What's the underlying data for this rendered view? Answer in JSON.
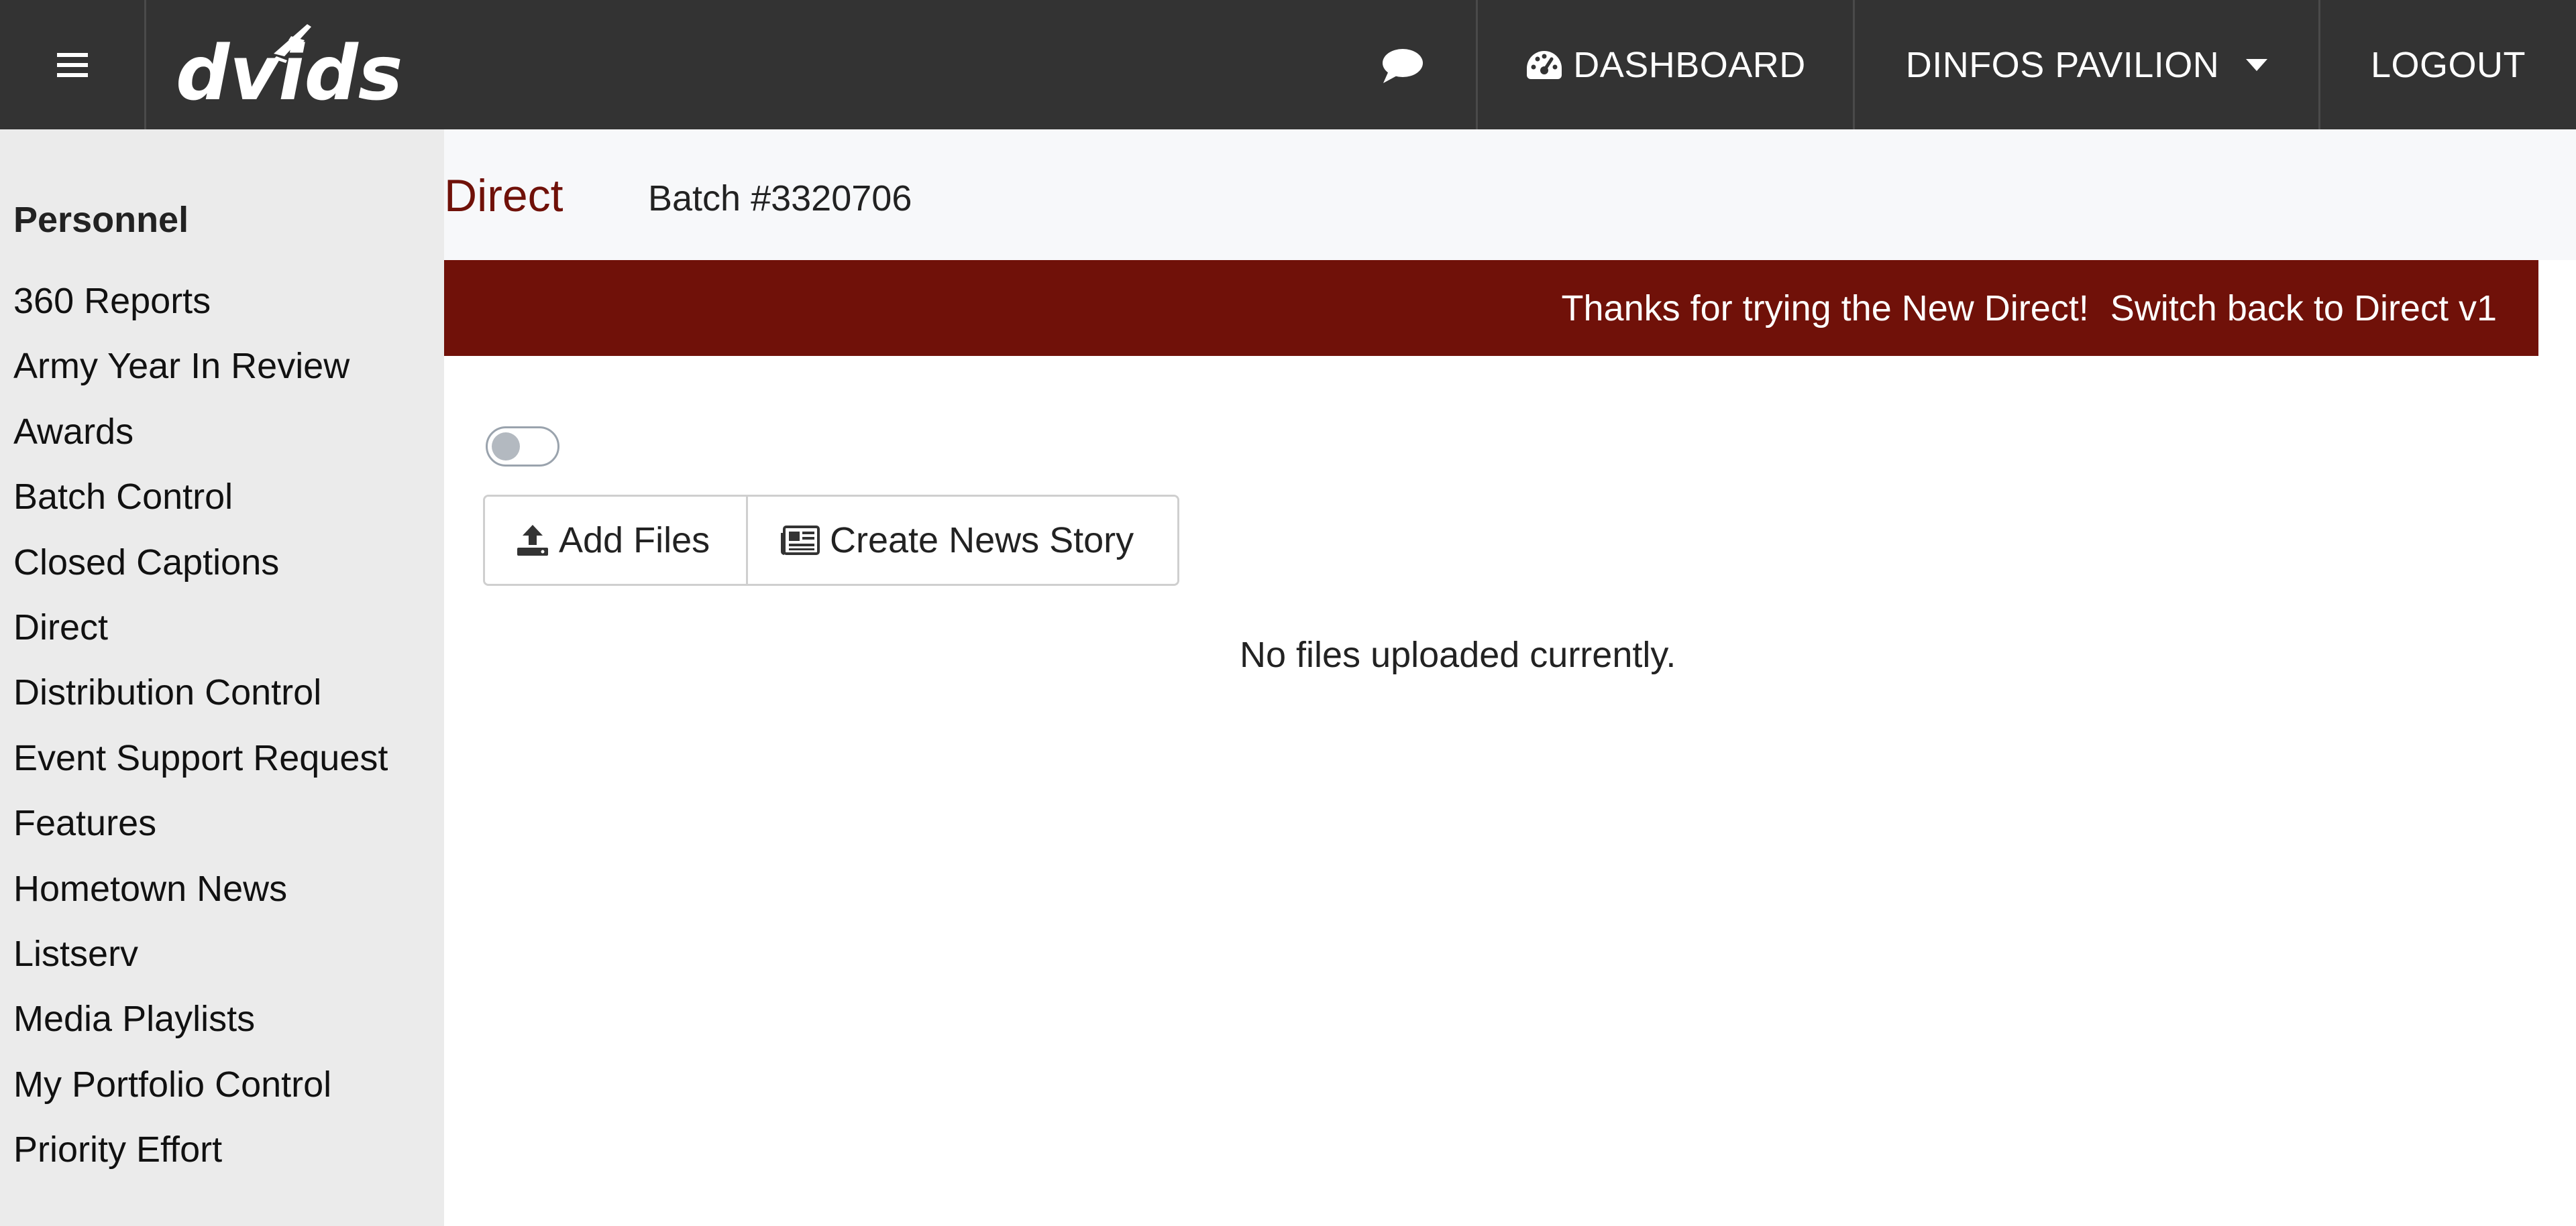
{
  "topbar": {
    "logo_text": "dvids",
    "nav": {
      "dashboard": "DASHBOARD",
      "pavilion": "DINFOS PAVILION",
      "logout": "LOGOUT"
    },
    "icons": {
      "menu": "hamburger-icon",
      "chat": "chat-bubble-icon",
      "dashboard": "speedometer-icon",
      "dropdown": "caret-down-icon"
    }
  },
  "sidebar": {
    "heading": "Personnel",
    "items": [
      "360 Reports",
      "Army Year In Review",
      "Awards",
      "Batch Control",
      "Closed Captions",
      "Direct",
      "Distribution Control",
      "Event Support Request",
      "Features",
      "Hometown News",
      "Listserv",
      "Media Playlists",
      "My Portfolio Control",
      "Priority Effort"
    ]
  },
  "main": {
    "title": "Direct",
    "batch": "Batch #3320706",
    "banner": {
      "message": "Thanks for trying the New Direct!",
      "link": "Switch back to Direct v1"
    },
    "toggle_on": false,
    "buttons": {
      "add_files": "Add Files",
      "create_story": "Create News Story"
    },
    "empty_message": "No files uploaded currently."
  },
  "colors": {
    "topbar": "#333333",
    "accent": "#701109",
    "sidebar": "#ebebeb",
    "subheader": "#f7f8fa"
  }
}
